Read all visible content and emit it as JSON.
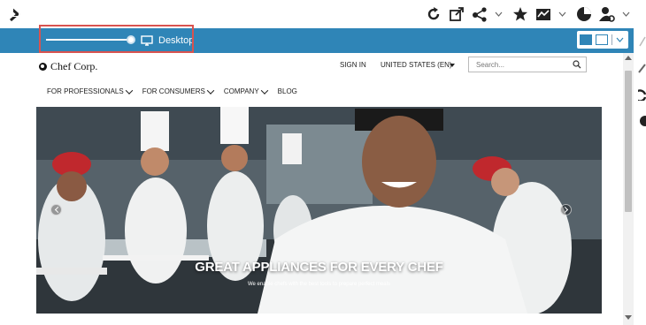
{
  "preview_bar": {
    "device_label": "Desktop",
    "slider_level": 1.0
  },
  "site": {
    "logo_text": "Chef Corp.",
    "sign_in": "SIGN IN",
    "region": "UNITED STATES (EN)",
    "search_placeholder": "Search...",
    "nav": [
      {
        "label": "FOR PROFESSIONALS",
        "has_menu": true
      },
      {
        "label": "FOR CONSUMERS",
        "has_menu": true
      },
      {
        "label": "COMPANY",
        "has_menu": true
      },
      {
        "label": "BLOG",
        "has_menu": false
      }
    ],
    "hero": {
      "title": "GREAT APPLIANCES FOR EVERY CHEF",
      "subtitle": "We enable chefs with the best tools to prepare perfect meals"
    }
  },
  "toolbar": {
    "icons": [
      "chevron-right-icon",
      "refresh-icon",
      "open-external-icon",
      "share-icon",
      "star-icon",
      "chart-icon",
      "pie-chart-icon",
      "user-settings-icon"
    ]
  },
  "colors": {
    "preview_bar": "#2f85b7",
    "highlight_border": "#d9534f"
  }
}
